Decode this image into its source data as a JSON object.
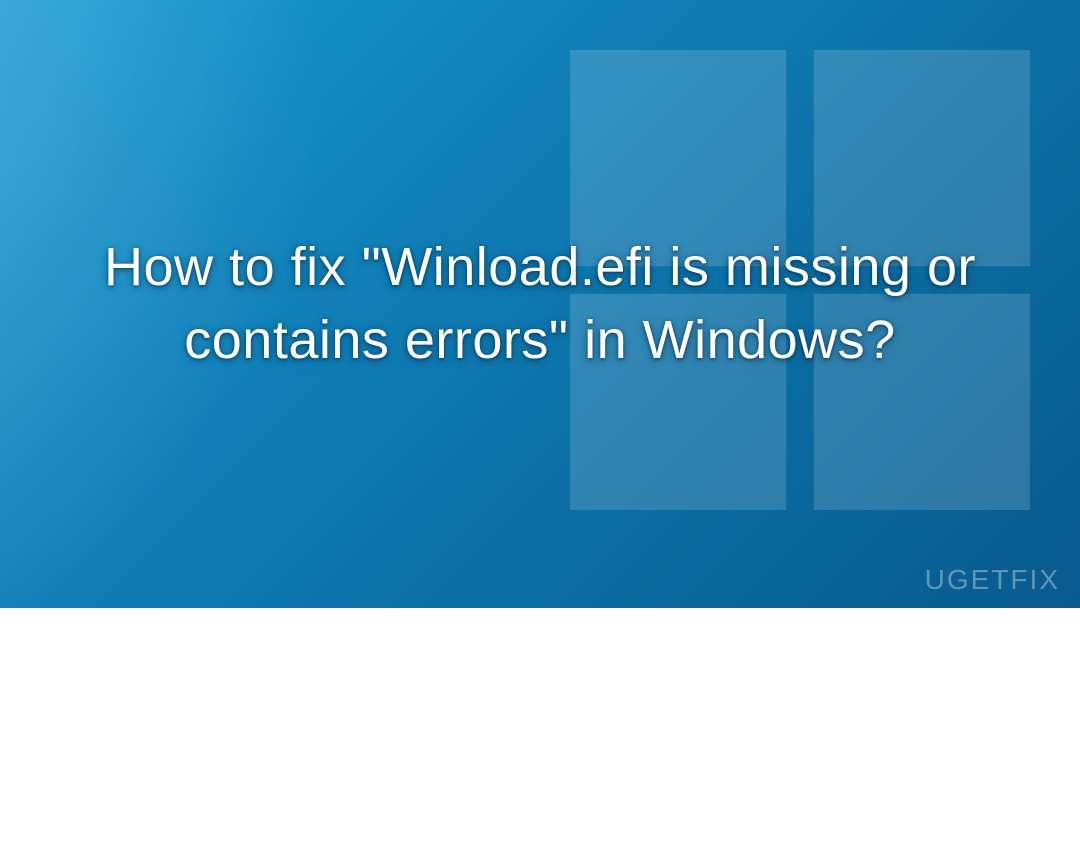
{
  "title": "How to fix \"Winload.efi is missing or contains errors\" in Windows?",
  "watermark": "UGETFIX",
  "logo_name": "windows-logo",
  "colors": {
    "background_start": "#1a9cd4",
    "background_end": "#085a8e",
    "text": "#ffffff",
    "logo_overlay": "#ffffff"
  }
}
